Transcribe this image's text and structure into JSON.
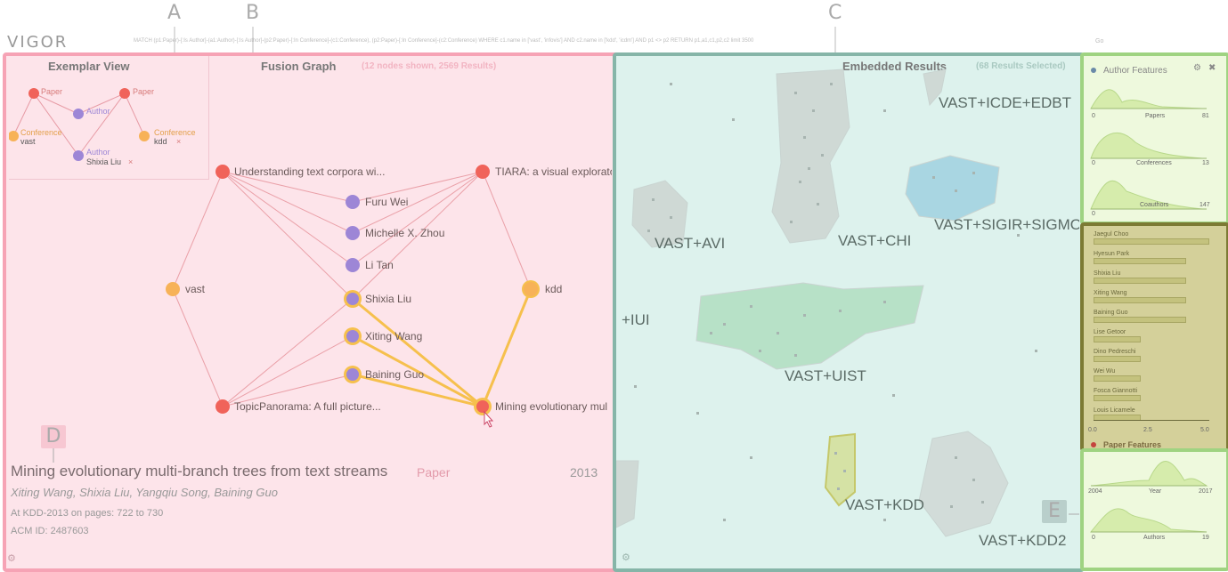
{
  "callouts": {
    "a": "A",
    "b": "B",
    "c": "C",
    "d": "D",
    "e": "E"
  },
  "app": {
    "logo": "VIGOR",
    "query": "MATCH (p1:Paper)-[:Is Author]-(a1:Author)-[:Is Author]-(p2:Paper)-[:In Conference]-(c1:Conference), (p2:Paper)-[:In Conference]-(c2:Conference) WHERE c1.name in ['vast', 'infovis'] AND c2.name in ['kdd', 'icdm'] AND p1 <> p2 RETURN p1,a1,c1,p2,c2 limit 3500",
    "go": "Go"
  },
  "exemplar": {
    "title": "Exemplar View",
    "nodes": [
      "Paper",
      "Paper",
      "Author",
      "Conference",
      "vast",
      "Conference",
      "kdd",
      "Author",
      "Shixia Liu"
    ],
    "remove": "×"
  },
  "fusion": {
    "title": "Fusion Graph",
    "subtitle": "(12 nodes shown, 2569 Results)",
    "nodes": {
      "p1": "Understanding text corpora wi...",
      "p2": "TIARA: a visual explorato",
      "a1": "Furu Wei",
      "a2": "Michelle X. Zhou",
      "a3": "Li Tan",
      "c1": "vast",
      "a4": "Shixia Liu",
      "c2": "kdd",
      "a5": "Xiting Wang",
      "a6": "Baining Guo",
      "p3": "TopicPanorama: A full picture...",
      "p4": "Mining evolutionary mul"
    }
  },
  "detail": {
    "title": "Mining evolutionary multi-branch trees from text streams",
    "type": "Paper",
    "year": "2013",
    "authors": "Xiting Wang, Shixia Liu, Yangqiu Song, Baining Guo",
    "venue": "At KDD-2013 on pages: 722 to 730",
    "acm": "ACM ID: 2487603"
  },
  "embedded": {
    "title": "Embedded Results",
    "subtitle": "(68 Results Selected)",
    "clusters": [
      "VAST+ICDE+EDBT",
      "VAST+AVI",
      "VAST+CHI",
      "VAST+SIGIR+SIGMO",
      "+IUI",
      "VAST+UIST",
      "VAST+KDD",
      "VAST+KDD2"
    ]
  },
  "side": {
    "author_title": "Author Features",
    "charts": [
      {
        "label": "Papers",
        "min": "0",
        "max": "81"
      },
      {
        "label": "Conferences",
        "min": "0",
        "max": "13"
      },
      {
        "label": "Coauthors",
        "min": "0",
        "max": "147"
      }
    ],
    "bars": [
      {
        "name": "Jaegul Choo",
        "value": 5.0
      },
      {
        "name": "Hyesun Park",
        "value": 4.0
      },
      {
        "name": "Shixia Liu",
        "value": 4.0
      },
      {
        "name": "Xiting Wang",
        "value": 4.0
      },
      {
        "name": "Baining Guo",
        "value": 4.0
      },
      {
        "name": "Lise Getoor",
        "value": 2.0
      },
      {
        "name": "Dino Pedreschi",
        "value": 2.0
      },
      {
        "name": "Wei Wu",
        "value": 2.0
      },
      {
        "name": "Fosca Giannotti",
        "value": 2.0
      },
      {
        "name": "Louis Licamele",
        "value": 2.0
      }
    ],
    "bar_axis": [
      "0.0",
      "2.5",
      "5.0"
    ],
    "paper_title": "Paper Features",
    "charts2": [
      {
        "label": "Year",
        "min": "2004",
        "max": "2017"
      },
      {
        "label": "Authors",
        "min": "0",
        "max": "19"
      }
    ]
  },
  "colors": {
    "paper": "#f0635a",
    "author": "#9d86d6",
    "conf": "#f7b258",
    "highlight": "#f6c04d"
  }
}
